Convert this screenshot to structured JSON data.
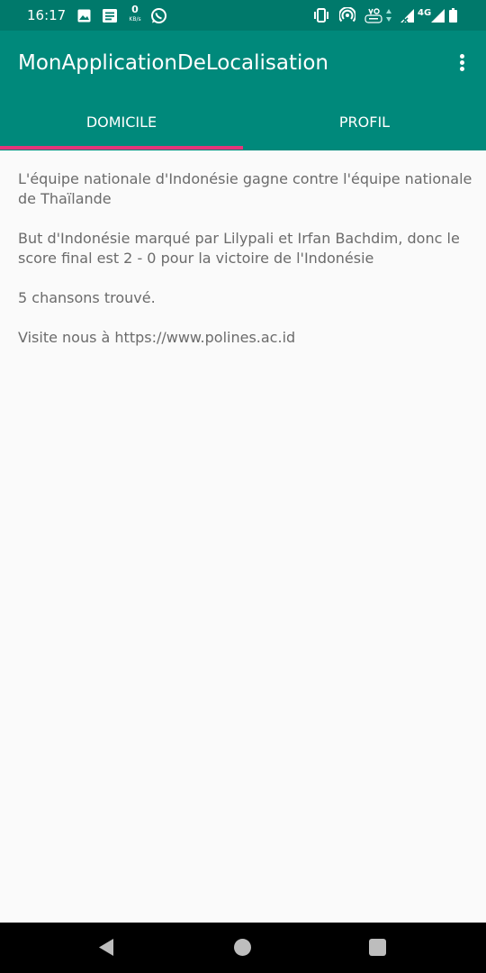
{
  "status_bar": {
    "time": "16:17",
    "net_speed_value": "0",
    "net_speed_unit": "KB/s",
    "network_type": "4G",
    "icons": [
      "image-icon",
      "message-icon",
      "whatsapp-icon",
      "vibrate-icon",
      "hotspot-icon",
      "volte-icon",
      "data-arrows-icon",
      "signal-icon",
      "battery-icon"
    ]
  },
  "app_bar": {
    "title": "MonApplicationDeLocalisation",
    "overflow_icon": "more-vert-icon"
  },
  "tabs": [
    {
      "label": "DOMICILE",
      "selected": true
    },
    {
      "label": "PROFIL",
      "selected": false
    }
  ],
  "colors": {
    "status_bar": "#00796b",
    "app_bar": "#00897b",
    "tab_indicator": "#e5347a",
    "background": "#fafafa",
    "body_text": "#6b6b6b"
  },
  "content": {
    "paragraphs": [
      "L'équipe nationale d'Indonésie gagne contre l'équipe nationale de Thaïlande",
      "But d'Indonésie marqué par Lilypali et Irfan Bachdim, donc le score final est 2 - 0 pour la victoire de l'Indonésie",
      "5 chansons trouvé.",
      "Visite nous à https://www.polines.ac.id"
    ]
  },
  "nav_bar": {
    "icons": [
      "back-icon",
      "home-icon",
      "recents-icon"
    ]
  }
}
